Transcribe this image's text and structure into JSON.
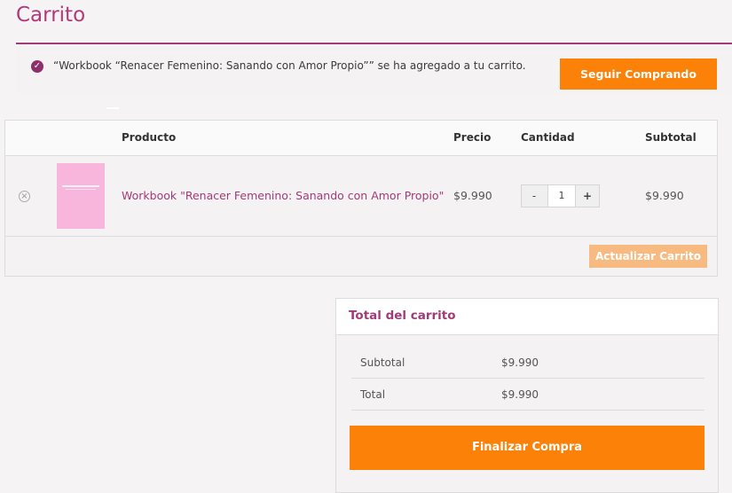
{
  "page": {
    "title": "Carrito"
  },
  "notice": {
    "icon": "check-circle-icon",
    "message": "“Workbook “Renacer Femenino: Sanando con Amor Propio”” se ha agregado a tu carrito.",
    "button": "Seguir Comprando"
  },
  "cart": {
    "headers": {
      "product": "Producto",
      "price": "Precio",
      "quantity": "Cantidad",
      "subtotal": "Subtotal"
    },
    "items": [
      {
        "name": "Workbook \"Renacer Femenino: Sanando con Amor Propio\"",
        "price": "$9.990",
        "quantity": "1",
        "subtotal": "$9.990"
      }
    ],
    "qty_minus": "-",
    "qty_plus": "+",
    "remove_symbol": "×",
    "update_button": "Actualizar Carrito"
  },
  "totals": {
    "title": "Total del carrito",
    "rows": [
      {
        "label": "Subtotal",
        "value": "$9.990"
      },
      {
        "label": "Total",
        "value": "$9.990"
      }
    ],
    "checkout_button": "Finalizar Compra"
  },
  "colors": {
    "accent": "#a33a78",
    "button": "#fb8109",
    "button_disabled": "#f7ba80",
    "thumbnail": "#f9b6dc"
  }
}
